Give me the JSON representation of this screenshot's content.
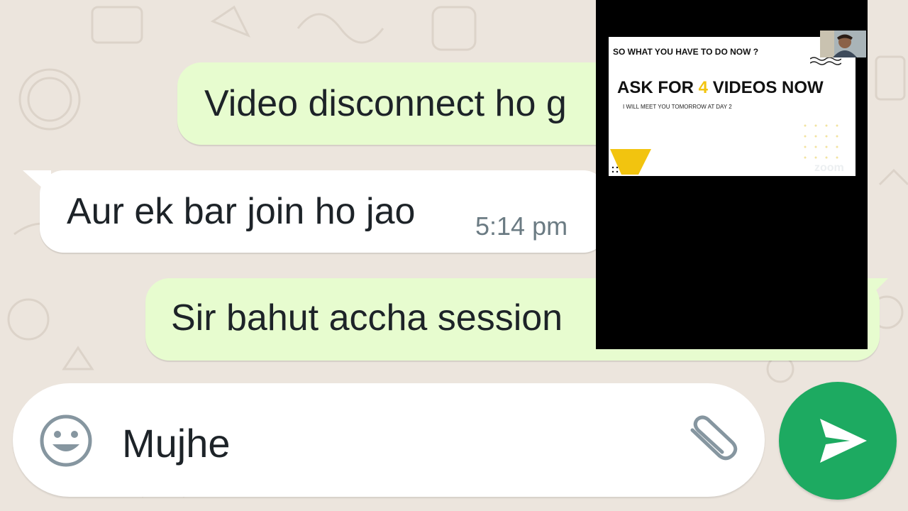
{
  "chat": {
    "messages": [
      {
        "direction": "outgoing",
        "text": "Video disconnect ho g"
      },
      {
        "direction": "incoming",
        "text": "Aur ek bar join ho jao",
        "time": "5:14 pm"
      },
      {
        "direction": "outgoing",
        "text": "Sir bahut accha session"
      }
    ]
  },
  "composer": {
    "emoji_icon": "smiley-icon",
    "input_value": "Mujhe",
    "attach_icon": "paperclip-icon",
    "send_icon": "send-arrow-icon"
  },
  "pip_video": {
    "slide": {
      "heading": "SO WHAT YOU HAVE TO DO NOW ?",
      "title_prefix": "ASK FOR ",
      "title_number": "4",
      "title_suffix": " VIDEOS NOW",
      "subtitle": "I WILL MEET YOU TOMORROW AT DAY 2",
      "watermark": "zoom"
    }
  },
  "colors": {
    "outgoing_bubble": "#e7fccf",
    "incoming_bubble": "#ffffff",
    "send_button": "#1daa61",
    "slide_accent": "#f2c40f"
  }
}
